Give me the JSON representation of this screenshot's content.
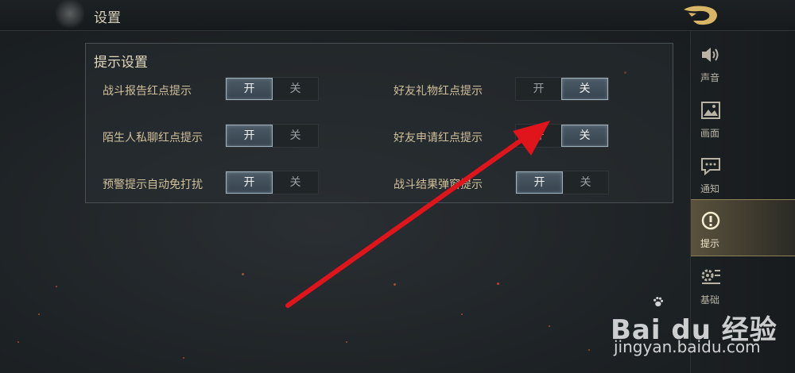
{
  "header": {
    "title": "设置"
  },
  "panel": {
    "title": "提示设置",
    "settings": [
      {
        "label": "战斗报告红点提示",
        "on": "开",
        "off": "关",
        "state": "on"
      },
      {
        "label": "好友礼物红点提示",
        "on": "开",
        "off": "关",
        "state": "off"
      },
      {
        "label": "陌生人私聊红点提示",
        "on": "开",
        "off": "关",
        "state": "on"
      },
      {
        "label": "好友申请红点提示",
        "on": "开",
        "off": "关",
        "state": "off"
      },
      {
        "label": "预警提示自动免打扰",
        "on": "开",
        "off": "关",
        "state": "on"
      },
      {
        "label": "战斗结果弹窗提示",
        "on": "开",
        "off": "关",
        "state": "on"
      }
    ]
  },
  "sidebar": {
    "items": [
      {
        "label": "声音",
        "icon": "speaker-icon"
      },
      {
        "label": "画面",
        "icon": "image-icon"
      },
      {
        "label": "通知",
        "icon": "chat-icon"
      },
      {
        "label": "提示",
        "icon": "exclamation-icon",
        "active": true
      },
      {
        "label": "基础",
        "icon": "gear-list-icon"
      }
    ]
  },
  "watermark": {
    "brand": "Bai du 经验",
    "url": "jingyan.baidu.com"
  },
  "colors": {
    "accent": "#cfc09a",
    "arrow": "#e0151c",
    "active_nav": "#5a523d"
  }
}
